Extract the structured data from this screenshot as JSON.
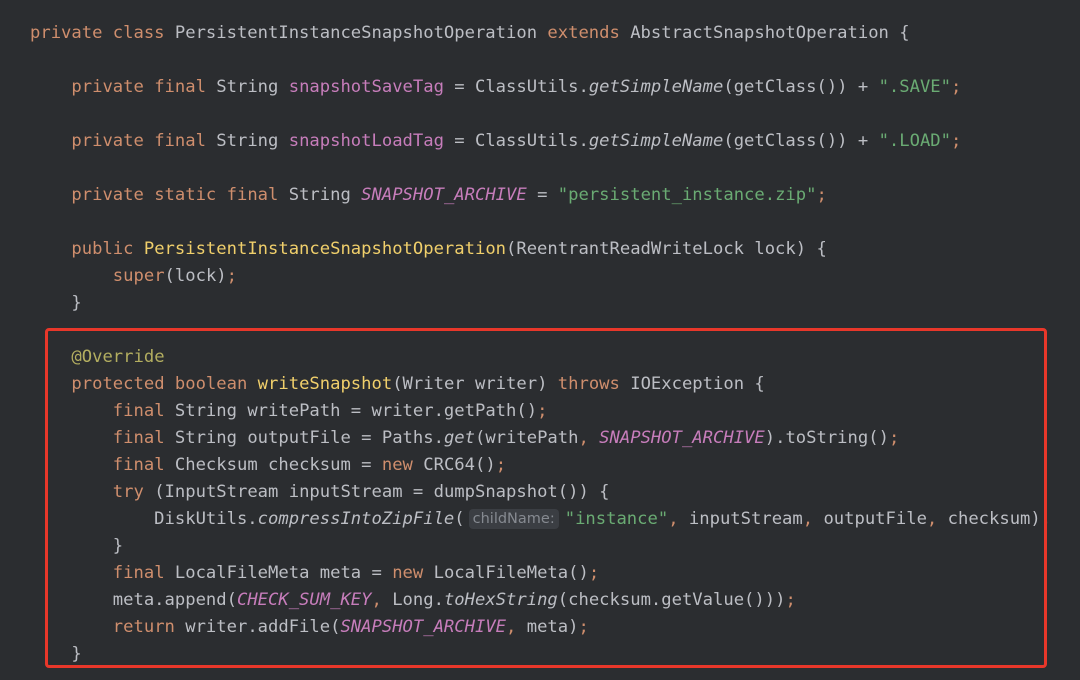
{
  "colors": {
    "background": "#2b2d30",
    "keyword": "#cf8e6d",
    "field": "#c77dbb",
    "method_declaration": "#f0cf6b",
    "string": "#6aab73",
    "annotation": "#b3ae60",
    "highlight_border": "#e8372a"
  },
  "code": {
    "lines": [
      [
        [
          "k",
          "private class "
        ],
        [
          "t",
          "PersistentInstanceSnapshotOperation "
        ],
        [
          "k",
          "extends "
        ],
        [
          "t",
          "AbstractSnapshotOperation {"
        ]
      ],
      [
        [
          "t",
          "    "
        ],
        [
          "k",
          "private final "
        ],
        [
          "t",
          "String "
        ],
        [
          "f",
          "snapshotSaveTag"
        ],
        [
          "t",
          " = ClassUtils."
        ],
        [
          "i",
          "getSimpleName"
        ],
        [
          "t",
          "(getClass()) + "
        ],
        [
          "s",
          "\".SAVE\""
        ],
        [
          "k",
          ";"
        ]
      ],
      [
        [
          "t",
          "    "
        ],
        [
          "k",
          "private final "
        ],
        [
          "t",
          "String "
        ],
        [
          "f",
          "snapshotLoadTag"
        ],
        [
          "t",
          " = ClassUtils."
        ],
        [
          "i",
          "getSimpleName"
        ],
        [
          "t",
          "(getClass()) + "
        ],
        [
          "s",
          "\".LOAD\""
        ],
        [
          "k",
          ";"
        ]
      ],
      [
        [
          "t",
          "    "
        ],
        [
          "k",
          "private static final "
        ],
        [
          "t",
          "String "
        ],
        [
          "sf",
          "SNAPSHOT_ARCHIVE"
        ],
        [
          "t",
          " = "
        ],
        [
          "s",
          "\"persistent_instance.zip\""
        ],
        [
          "k",
          ";"
        ]
      ],
      [
        [
          "t",
          "    "
        ],
        [
          "k",
          "public "
        ],
        [
          "mdecl",
          "PersistentInstanceSnapshotOperation"
        ],
        [
          "t",
          "(ReentrantReadWriteLock lock) {"
        ]
      ],
      [
        [
          "t",
          "        "
        ],
        [
          "k",
          "super"
        ],
        [
          "t",
          "(lock)"
        ],
        [
          "k",
          ";"
        ]
      ],
      [
        [
          "t",
          "    }"
        ]
      ],
      [
        [
          "t",
          "    "
        ],
        [
          "a",
          "@Override"
        ]
      ],
      [
        [
          "t",
          "    "
        ],
        [
          "k",
          "protected boolean "
        ],
        [
          "mdecl",
          "writeSnapshot"
        ],
        [
          "t",
          "(Writer writer) "
        ],
        [
          "k",
          "throws "
        ],
        [
          "t",
          "IOException {"
        ]
      ],
      [
        [
          "t",
          "        "
        ],
        [
          "k",
          "final "
        ],
        [
          "t",
          "String writePath = writer.getPath()"
        ],
        [
          "k",
          ";"
        ]
      ],
      [
        [
          "t",
          "        "
        ],
        [
          "k",
          "final "
        ],
        [
          "t",
          "String outputFile = Paths."
        ],
        [
          "i",
          "get"
        ],
        [
          "t",
          "(writePath"
        ],
        [
          "k",
          ", "
        ],
        [
          "sf",
          "SNAPSHOT_ARCHIVE"
        ],
        [
          "t",
          ").toString()"
        ],
        [
          "k",
          ";"
        ]
      ],
      [
        [
          "t",
          "        "
        ],
        [
          "k",
          "final "
        ],
        [
          "t",
          "Checksum checksum = "
        ],
        [
          "k",
          "new "
        ],
        [
          "t",
          "CRC64()"
        ],
        [
          "k",
          ";"
        ]
      ],
      [
        [
          "t",
          "        "
        ],
        [
          "k",
          "try "
        ],
        [
          "t",
          "(InputStream inputStream = dumpSnapshot()) {"
        ]
      ],
      [
        [
          "t",
          "            DiskUtils."
        ],
        [
          "i",
          "compressIntoZipFile"
        ],
        [
          "t",
          "("
        ],
        [
          "hint",
          "childName:"
        ],
        [
          "s",
          "\"instance\""
        ],
        [
          "k",
          ", "
        ],
        [
          "t",
          "inputStream"
        ],
        [
          "k",
          ", "
        ],
        [
          "t",
          "outputFile"
        ],
        [
          "k",
          ", "
        ],
        [
          "t",
          "checksum)"
        ],
        [
          "k",
          ";"
        ]
      ],
      [
        [
          "t",
          "        }"
        ]
      ],
      [
        [
          "t",
          "        "
        ],
        [
          "k",
          "final "
        ],
        [
          "t",
          "LocalFileMeta meta = "
        ],
        [
          "k",
          "new "
        ],
        [
          "t",
          "LocalFileMeta()"
        ],
        [
          "k",
          ";"
        ]
      ],
      [
        [
          "t",
          "        meta.append("
        ],
        [
          "sf",
          "CHECK_SUM_KEY"
        ],
        [
          "k",
          ", "
        ],
        [
          "t",
          "Long."
        ],
        [
          "i",
          "toHexString"
        ],
        [
          "t",
          "(checksum.getValue()))"
        ],
        [
          "k",
          ";"
        ]
      ],
      [
        [
          "t",
          "        "
        ],
        [
          "k",
          "return "
        ],
        [
          "t",
          "writer.addFile("
        ],
        [
          "sf",
          "SNAPSHOT_ARCHIVE"
        ],
        [
          "k",
          ", "
        ],
        [
          "t",
          "meta)"
        ],
        [
          "k",
          ";"
        ]
      ],
      [
        [
          "t",
          "    }"
        ]
      ]
    ]
  }
}
